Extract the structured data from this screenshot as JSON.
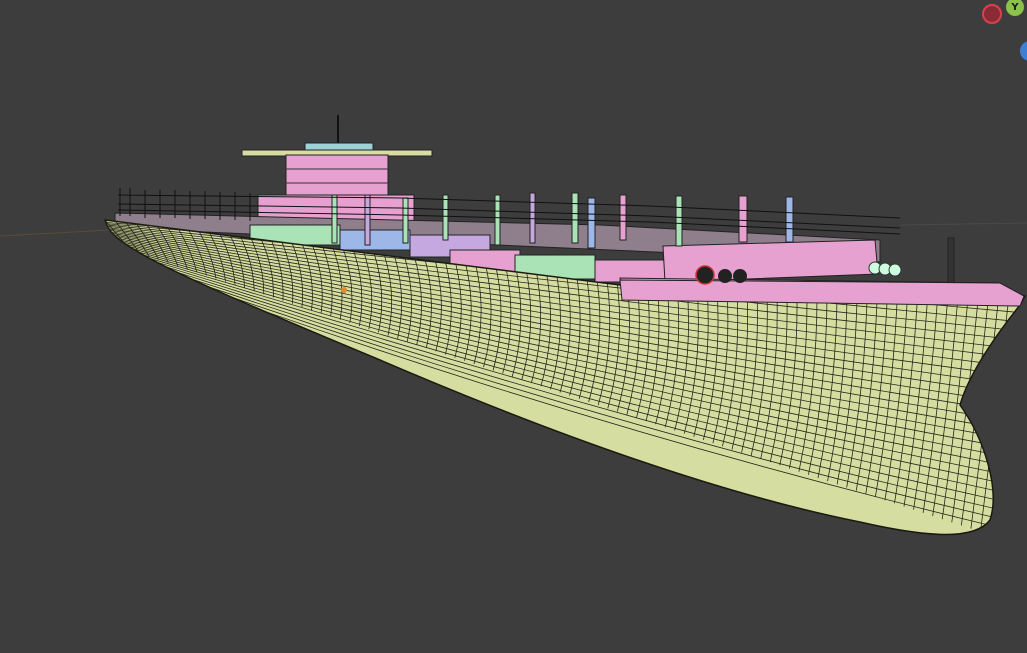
{
  "viewport": {
    "background": "#3d3d3d",
    "object": "container-ship-wireframe",
    "colors": {
      "hull": "#d6dda0",
      "hull_wire": "#202010",
      "superstructure": "#e7a1d0",
      "deck_accent": "#a9e3b6",
      "container_blue": "#9db7e8"
    }
  },
  "gizmo": {
    "x_label": "",
    "y_label": "Y",
    "z_label": "",
    "x_color": "#d9414e",
    "y_color": "#8bc34a",
    "z_color": "#3d7fd6"
  }
}
